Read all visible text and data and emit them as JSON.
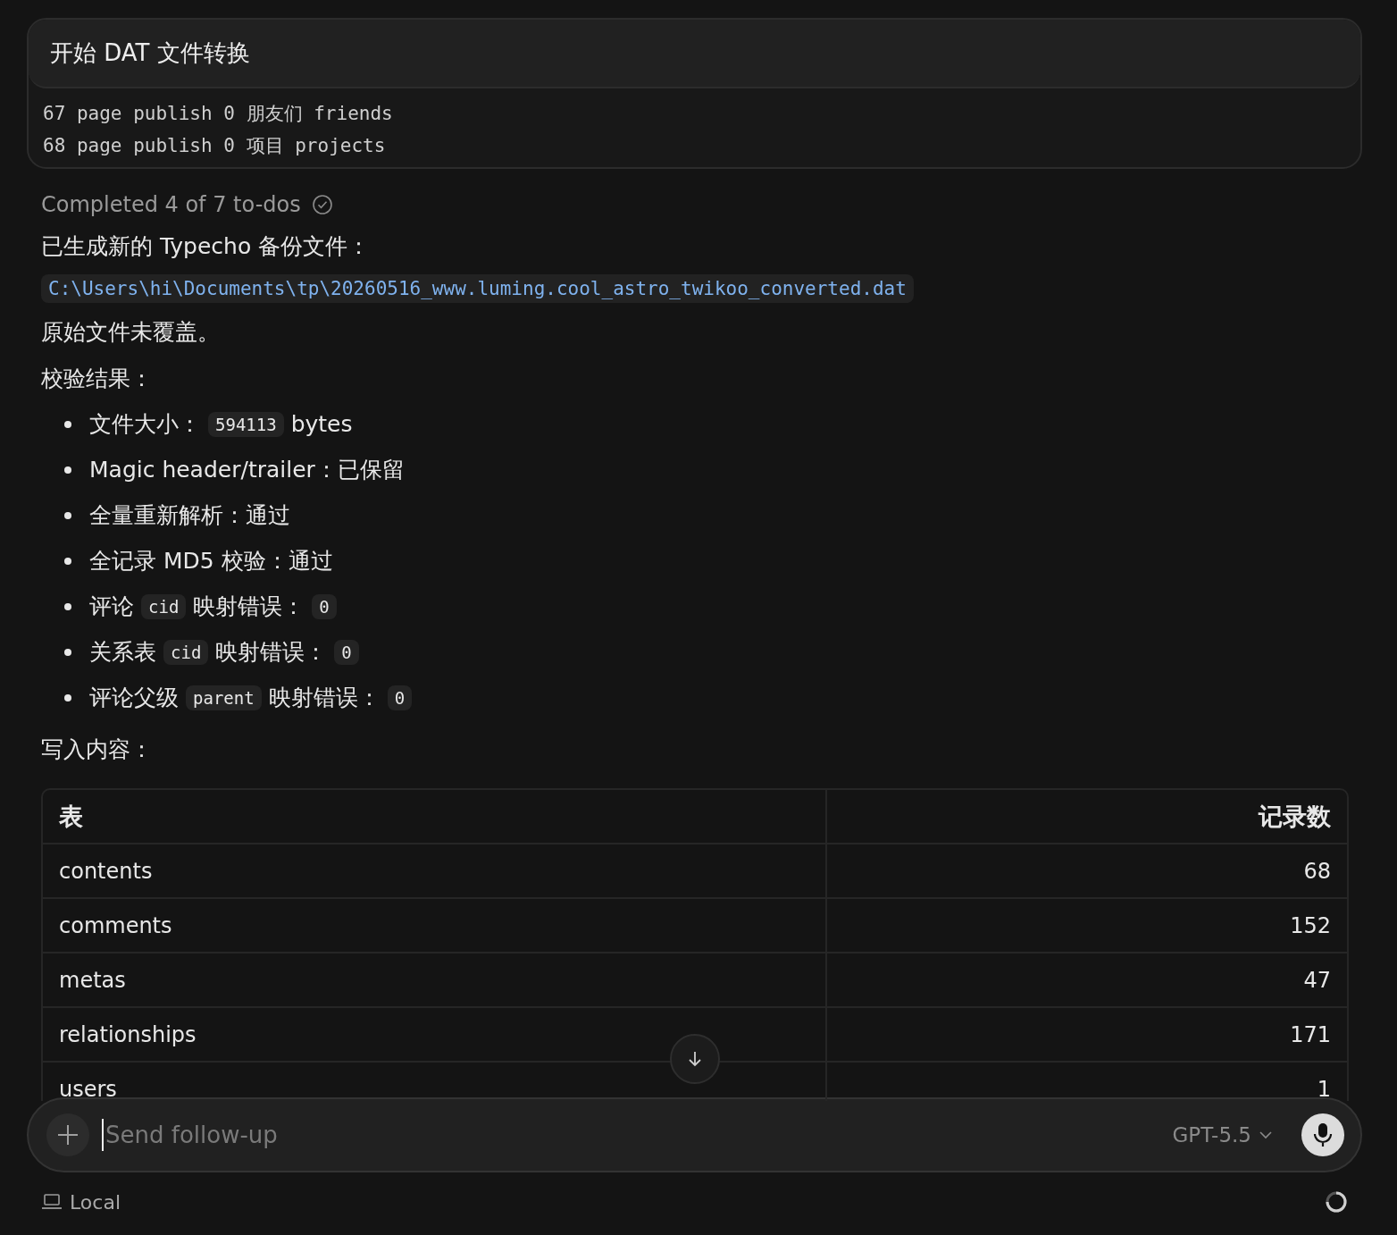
{
  "task_card": {
    "title": "开始 DAT 文件转换",
    "lines": [
      "67 page publish 0 朋友们 friends",
      "68 page publish 0 项目 projects"
    ]
  },
  "todo_status": "Completed 4 of 7 to-dos",
  "message": {
    "intro": "已生成新的 Typecho 备份文件：",
    "file_path": "C:\\Users\\hi\\Documents\\tp\\20260516_www.luming.cool_astro_twikoo_converted.dat",
    "note": "原始文件未覆盖。",
    "check_heading": "校验结果：",
    "checks": [
      [
        {
          "kind": "text",
          "text": "文件大小："
        },
        {
          "kind": "code",
          "text": "594113"
        },
        {
          "kind": "text",
          "text": "bytes"
        }
      ],
      [
        {
          "kind": "text",
          "text": "Magic header/trailer：已保留"
        }
      ],
      [
        {
          "kind": "text",
          "text": "全量重新解析：通过"
        }
      ],
      [
        {
          "kind": "text",
          "text": "全记录 MD5 校验：通过"
        }
      ],
      [
        {
          "kind": "text",
          "text": "评论"
        },
        {
          "kind": "code",
          "text": "cid"
        },
        {
          "kind": "text",
          "text": "映射错误："
        },
        {
          "kind": "code",
          "text": "0"
        }
      ],
      [
        {
          "kind": "text",
          "text": "关系表"
        },
        {
          "kind": "code",
          "text": "cid"
        },
        {
          "kind": "text",
          "text": "映射错误："
        },
        {
          "kind": "code",
          "text": "0"
        }
      ],
      [
        {
          "kind": "text",
          "text": "评论父级"
        },
        {
          "kind": "code",
          "text": "parent"
        },
        {
          "kind": "text",
          "text": "映射错误："
        },
        {
          "kind": "code",
          "text": "0"
        }
      ]
    ],
    "write_heading": "写入内容：",
    "table": {
      "columns": [
        "表",
        "记录数"
      ],
      "rows": [
        [
          "contents",
          "68"
        ],
        [
          "comments",
          "152"
        ],
        [
          "metas",
          "47"
        ],
        [
          "relationships",
          "171"
        ],
        [
          "users",
          "1"
        ]
      ]
    }
  },
  "composer": {
    "placeholder": "Send follow-up",
    "model": "GPT-5.5"
  },
  "footer": {
    "environment": "Local"
  }
}
